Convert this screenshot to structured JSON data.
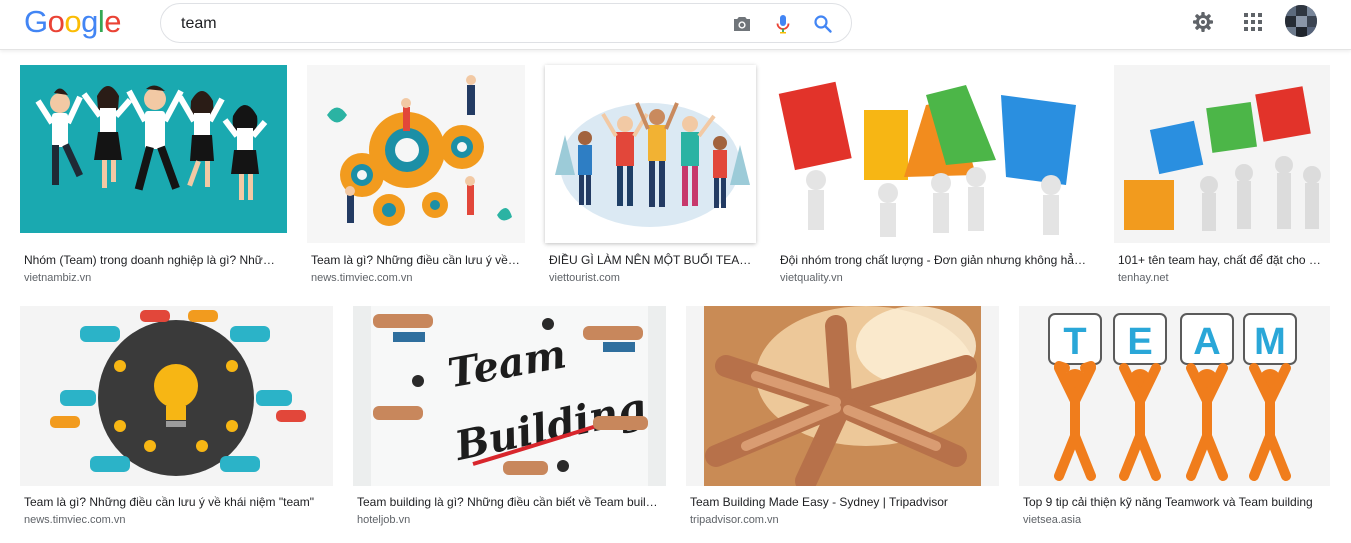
{
  "brand": {
    "logo_letters": [
      "G",
      "o",
      "o",
      "g",
      "l",
      "e"
    ],
    "logo_colors": [
      "#4285F4",
      "#EA4335",
      "#FBBC05",
      "#4285F4",
      "#34A853",
      "#EA4335"
    ]
  },
  "search": {
    "query": "team",
    "camera_icon": "camera-icon",
    "mic_icon": "microphone-icon",
    "search_icon": "search-icon"
  },
  "header_icons": {
    "settings": "gear-icon",
    "apps": "apps-grid-icon",
    "account": "avatar"
  },
  "results": [
    {
      "title": "Nhóm (Team) trong doanh nghiệp là gì? Nhữ…",
      "source": "vietnambiz.vn"
    },
    {
      "title": "Team là gì? Những điều cần lưu ý về …",
      "source": "news.timviec.com.vn"
    },
    {
      "title": "ĐIỀU GÌ LÀM NÊN MỘT BUỔI TEAM…",
      "source": "viettourist.com"
    },
    {
      "title": "Đội nhóm trong chất lượng - Đơn giản nhưng không hẳ…",
      "source": "vietquality.vn"
    },
    {
      "title": "101+ tên team hay, chất để đặt cho …",
      "source": "tenhay.net"
    },
    {
      "title": "Team là gì? Những điều cần lưu ý về khái niệm \"team\"",
      "source": "news.timviec.com.vn"
    },
    {
      "title": "Team building là gì? Những điều cần biết về Team buil…",
      "source": "hoteljob.vn"
    },
    {
      "title": "Team Building Made Easy - Sydney | Tripadvisor",
      "source": "tripadvisor.com.vn"
    },
    {
      "title": "Top 9 tip cải thiện kỹ năng Teamwork và Team building",
      "source": "vietsea.asia"
    }
  ],
  "image_text": {
    "team_letters": [
      "T",
      "E",
      "A",
      "M"
    ],
    "team_word": "Team",
    "building_word": "Building"
  }
}
